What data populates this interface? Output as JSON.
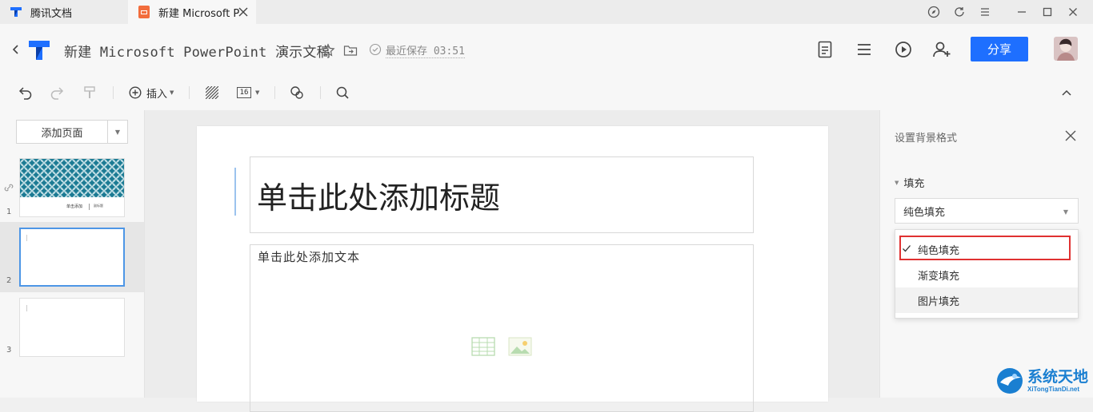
{
  "tabs": [
    {
      "label": "腾讯文档"
    },
    {
      "label": "新建 Microsoft P"
    }
  ],
  "header": {
    "doc_title": "新建 Microsoft PowerPoint 演示文稿",
    "save_status": "最近保存 03:51",
    "share_label": "分享"
  },
  "toolbar": {
    "insert_label": "插入",
    "font_size": "16"
  },
  "left_panel": {
    "add_page_label": "添加页面",
    "thumbnails": [
      {
        "number": "1",
        "caption_left": "单击添加",
        "caption_right": "副标题"
      },
      {
        "number": "2"
      },
      {
        "number": "3"
      }
    ]
  },
  "slide": {
    "title_placeholder": "单击此处添加标题",
    "body_placeholder": "单击此处添加文本"
  },
  "right_panel": {
    "title": "设置背景格式",
    "fill_section_label": "填充",
    "fill_selected": "纯色填充",
    "fill_options": [
      "纯色填充",
      "渐变填充",
      "图片填充"
    ]
  },
  "watermark": {
    "text": "系统天地",
    "url_text": "XiTongTianDi.net"
  },
  "colors": {
    "accent": "#1e6fff",
    "highlight": "#e03131",
    "thumb_pattern": "#1a7a93"
  }
}
